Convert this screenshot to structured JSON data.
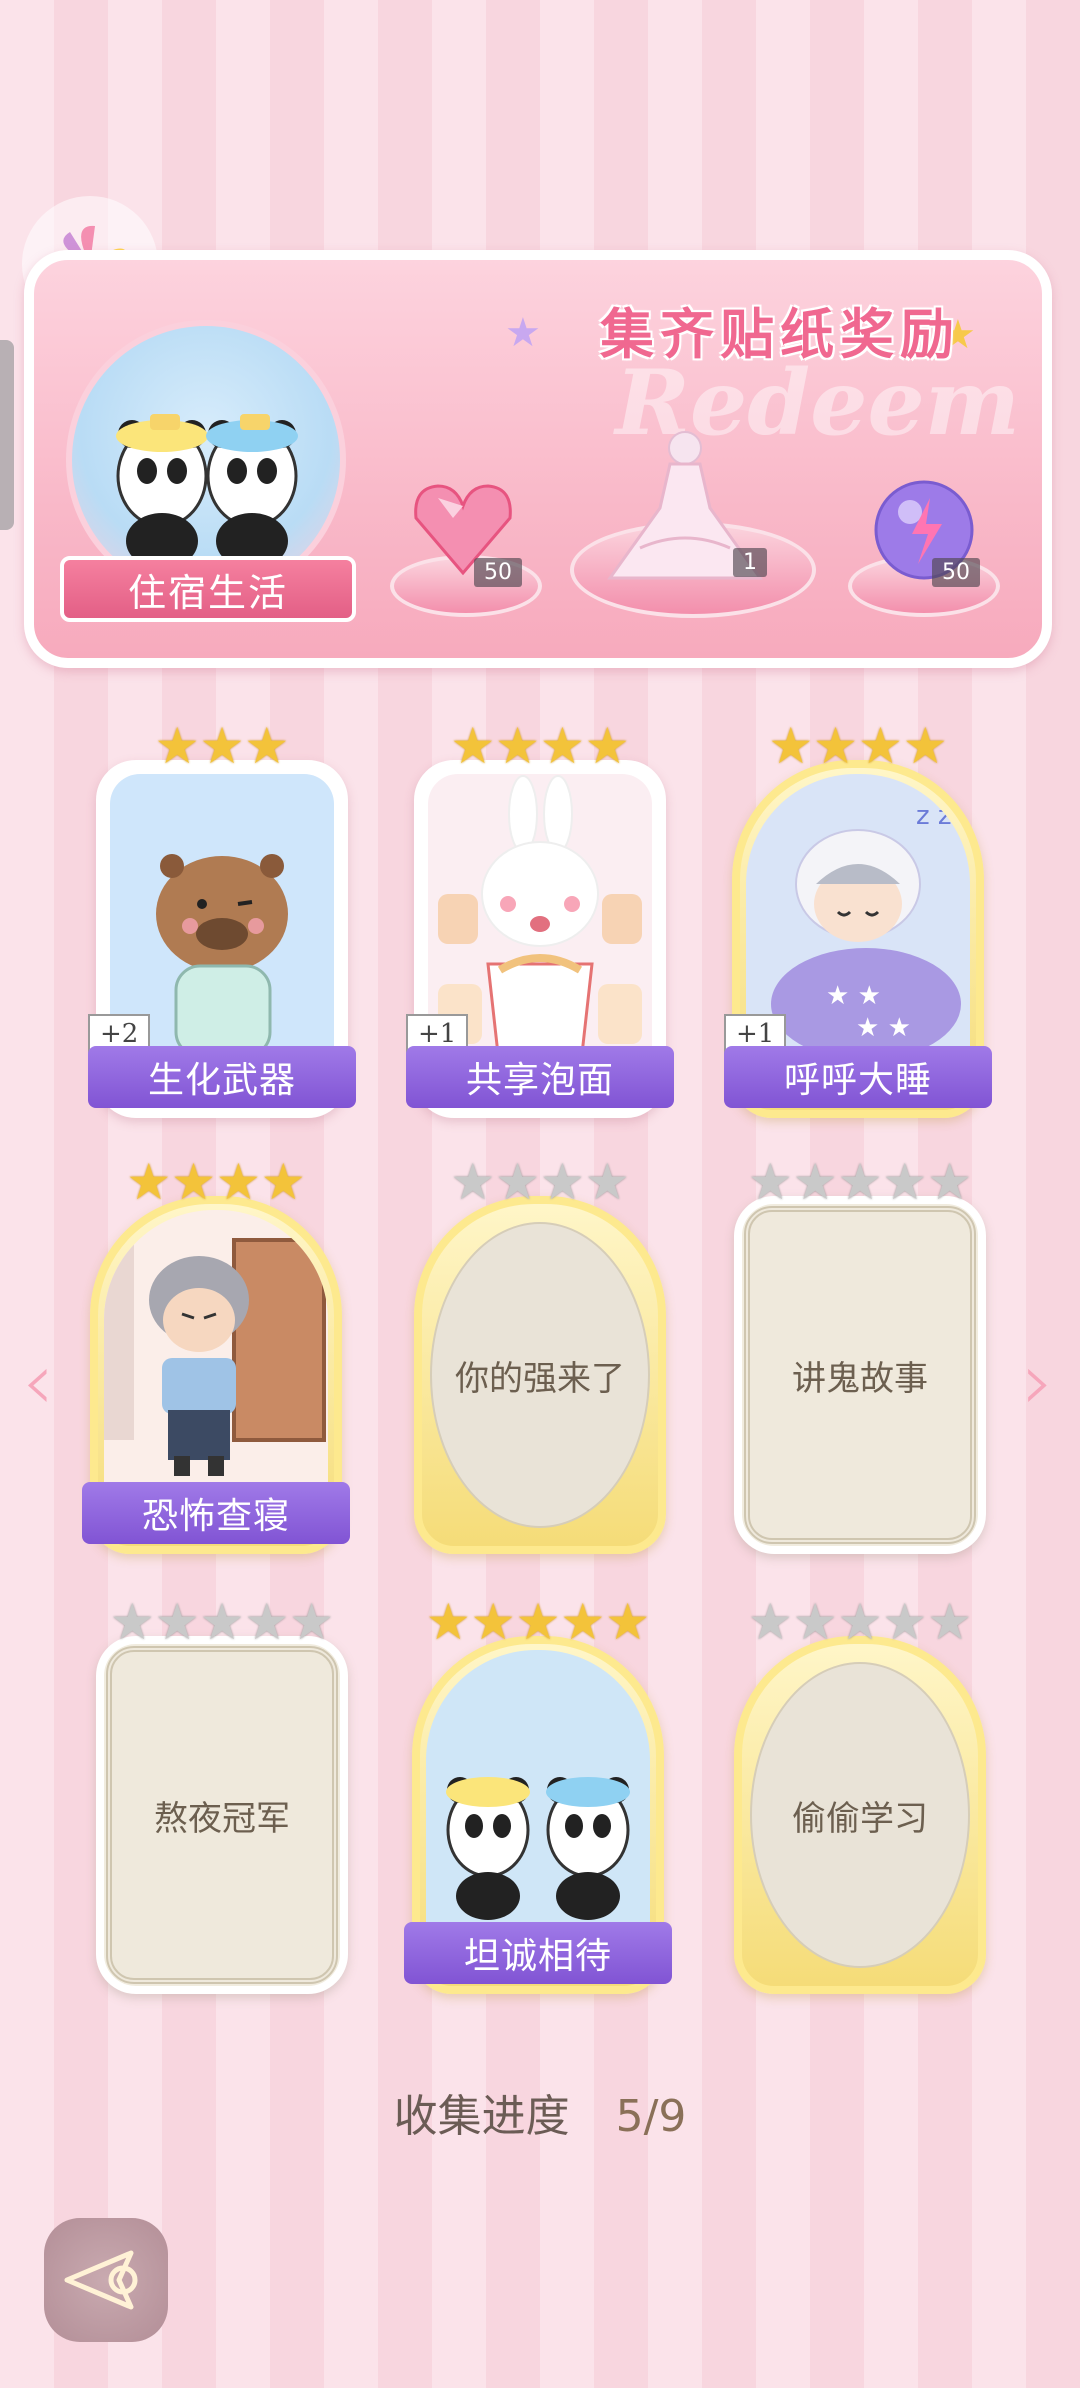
{
  "banner": {
    "title": "集齐贴纸奖励",
    "watermark": "Redeem",
    "theme_label": "住宿生活",
    "rewards": [
      {
        "icon": "pink-diamond-heart-icon",
        "count": "50"
      },
      {
        "icon": "dress-outfit-icon",
        "count": "1"
      },
      {
        "icon": "purple-energy-orb-icon",
        "count": "50"
      }
    ]
  },
  "cards": [
    {
      "name": "生化武器",
      "stars": 3,
      "star_color": "gold",
      "collected": true,
      "plus": "+2"
    },
    {
      "name": "共享泡面",
      "stars": 4,
      "star_color": "gold",
      "collected": true,
      "plus": "+1"
    },
    {
      "name": "呼呼大睡",
      "stars": 4,
      "star_color": "gold",
      "collected": true,
      "plus": "+1"
    },
    {
      "name": "恐怖查寝",
      "stars": 4,
      "star_color": "gold",
      "collected": true,
      "plus": ""
    },
    {
      "name": "你的强来了",
      "stars": 4,
      "star_color": "grey",
      "collected": false,
      "plus": ""
    },
    {
      "name": "讲鬼故事",
      "stars": 5,
      "star_color": "grey",
      "collected": false,
      "plus": ""
    },
    {
      "name": "熬夜冠军",
      "stars": 5,
      "star_color": "grey",
      "collected": false,
      "plus": ""
    },
    {
      "name": "坦诚相待",
      "stars": 5,
      "star_color": "gold",
      "collected": true,
      "plus": ""
    },
    {
      "name": "偷偷学习",
      "stars": 5,
      "star_color": "grey",
      "collected": false,
      "plus": ""
    }
  ],
  "progress": {
    "label": "收集进度",
    "value": "5/9"
  },
  "nav": {
    "prev_icon": "chevron-left-icon",
    "next_icon": "chevron-right-icon",
    "back_icon": "back-arrow-icon"
  }
}
